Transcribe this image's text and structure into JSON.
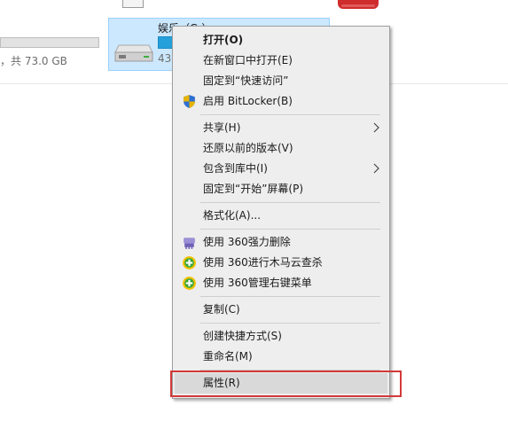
{
  "background": {
    "left_caption": "，共 73.0 GB",
    "tile": {
      "name": "娱乐（G:）",
      "size_text": "43"
    }
  },
  "context_menu": {
    "items": [
      {
        "label": "打开(O)",
        "bold": true
      },
      {
        "label": "在新窗口中打开(E)"
      },
      {
        "label": "固定到“快速访问”"
      },
      {
        "label": "启用 BitLocker(B)",
        "icon": "shield-icon"
      },
      {
        "label": "共享(H)",
        "submenu": true
      },
      {
        "label": "还原以前的版本(V)"
      },
      {
        "label": "包含到库中(I)",
        "submenu": true
      },
      {
        "label": "固定到“开始”屏幕(P)"
      },
      {
        "label": "格式化(A)..."
      },
      {
        "label": "使用 360强力删除",
        "icon": "360-shredder-icon"
      },
      {
        "label": "使用 360进行木马云查杀",
        "icon": "360-antivirus-icon"
      },
      {
        "label": "使用 360管理右键菜单",
        "icon": "360-antivirus-icon"
      },
      {
        "label": "复制(C)"
      },
      {
        "label": "创建快捷方式(S)"
      },
      {
        "label": "重命名(M)"
      },
      {
        "label": "属性(R)",
        "highlighted": true
      }
    ]
  },
  "colors": {
    "menu_bg": "#eeeeee",
    "highlight": "#d9d9d9",
    "selection_tile": "#cce8ff",
    "annotation_box": "#d33a3a"
  }
}
